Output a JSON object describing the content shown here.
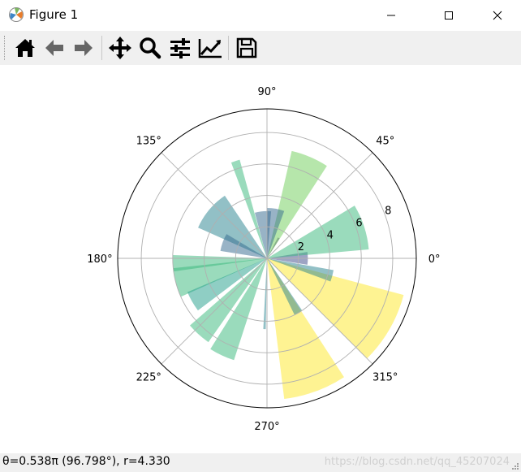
{
  "window": {
    "title": "Figure 1"
  },
  "window_controls": [
    {
      "name": "minimize-button",
      "icon": "minimize-icon"
    },
    {
      "name": "maximize-button",
      "icon": "maximize-icon"
    },
    {
      "name": "close-button",
      "icon": "close-icon"
    }
  ],
  "toolbar": {
    "buttons": [
      {
        "name": "home-button",
        "icon": "home-icon"
      },
      {
        "name": "back-button",
        "icon": "arrow-left-icon"
      },
      {
        "name": "forward-button",
        "icon": "arrow-right-icon"
      },
      {
        "name": "pan-button",
        "icon": "move-icon"
      },
      {
        "name": "zoom-button",
        "icon": "magnifier-icon"
      },
      {
        "name": "subplots-button",
        "icon": "sliders-icon"
      },
      {
        "name": "edit-axis-button",
        "icon": "line-chart-icon"
      },
      {
        "name": "save-button",
        "icon": "floppy-disk-icon"
      }
    ]
  },
  "status": {
    "readout": "θ=0.538π (96.798°), r=4.330",
    "watermark": "https://blog.csdn.net/qq_45207024"
  },
  "chart_data": {
    "type": "bar",
    "projection": "polar",
    "angle_tick_labels": [
      "0°",
      "45°",
      "90°",
      "135°",
      "180°",
      "225°",
      "270°",
      "315°"
    ],
    "radial_tick_labels": [
      "2",
      "4",
      "6",
      "8"
    ],
    "rlim": [
      0,
      9.5
    ],
    "grid": true,
    "colormap": "viridis",
    "alpha": 0.5,
    "bars": [
      {
        "theta_deg": 0,
        "width_deg": 18,
        "r": 2.6
      },
      {
        "theta_deg": 18,
        "width_deg": 26,
        "r": 6.5
      },
      {
        "theta_deg": 60,
        "width_deg": 5,
        "r": 1.5
      },
      {
        "theta_deg": 67,
        "width_deg": 20,
        "r": 7.0
      },
      {
        "theta_deg": 80,
        "width_deg": 20,
        "r": 3.2
      },
      {
        "theta_deg": 95,
        "width_deg": 20,
        "r": 3.0
      },
      {
        "theta_deg": 108,
        "width_deg": 5,
        "r": 6.5
      },
      {
        "theta_deg": 140,
        "width_deg": 32,
        "r": 4.8
      },
      {
        "theta_deg": 160,
        "width_deg": 22,
        "r": 3.0
      },
      {
        "theta_deg": 183,
        "width_deg": 10,
        "r": 6.0
      },
      {
        "theta_deg": 195,
        "width_deg": 18,
        "r": 6.0
      },
      {
        "theta_deg": 210,
        "width_deg": 14,
        "r": 5.5
      },
      {
        "theta_deg": 228,
        "width_deg": 14,
        "r": 6.5
      },
      {
        "theta_deg": 245,
        "width_deg": 14,
        "r": 6.8
      },
      {
        "theta_deg": 268,
        "width_deg": 2,
        "r": 4.5
      },
      {
        "theta_deg": 290,
        "width_deg": 26,
        "r": 9.0
      },
      {
        "theta_deg": 300,
        "width_deg": 8,
        "r": 4.0
      },
      {
        "theta_deg": 330,
        "width_deg": 30,
        "r": 9.0
      },
      {
        "theta_deg": 345,
        "width_deg": 10,
        "r": 4.3
      }
    ]
  }
}
